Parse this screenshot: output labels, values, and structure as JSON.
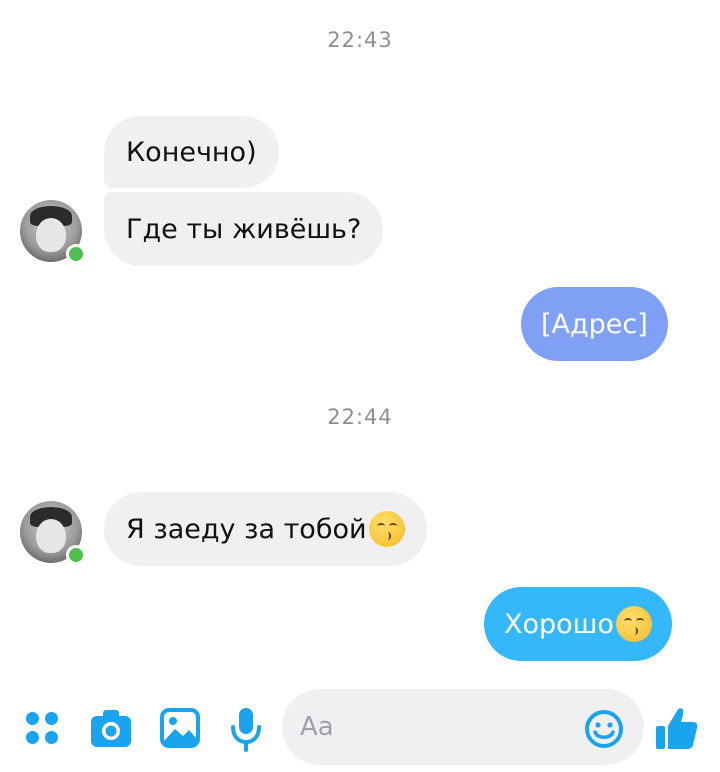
{
  "thread": {
    "timestamps": [
      "22:43",
      "22:44"
    ],
    "messages": [
      {
        "from": "contact",
        "text": "Конечно)"
      },
      {
        "from": "contact",
        "text": "Где ты живёшь?"
      },
      {
        "from": "me",
        "text": "[Адрес]"
      },
      {
        "from": "contact",
        "text": "Я заеду за тобой"
      },
      {
        "from": "me",
        "text": "Хорошо"
      }
    ]
  },
  "composer": {
    "placeholder": "Aa",
    "icons": [
      "apps-icon",
      "camera-icon",
      "image-icon",
      "microphone-icon",
      "emoji-icon",
      "thumbs-up-icon"
    ]
  },
  "colors": {
    "accent": "#1aa3ef",
    "outgoing_bubble_1": "#7fa0f5",
    "outgoing_bubble_2": "#35b7fb",
    "incoming_bubble": "#f0f0f2",
    "online": "#4cbf4c"
  }
}
